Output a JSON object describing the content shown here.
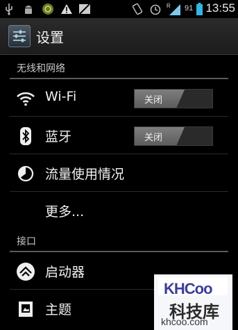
{
  "status_bar": {
    "time": "13:55",
    "battery_level": "91",
    "signal_label": "R",
    "icons": [
      "usb-icon",
      "android-debug-icon",
      "sync-icon",
      "warning-icon",
      "mute-icon",
      "vibrate-icon",
      "alarm-icon",
      "signal-icon",
      "battery-icon"
    ]
  },
  "action_bar": {
    "title": "设置",
    "icon": "settings-icon"
  },
  "sections": {
    "wireless": {
      "title": "无线和网络",
      "items": [
        {
          "label": "Wi-Fi",
          "icon": "wifi-icon",
          "toggle": "关闭"
        },
        {
          "label": "蓝牙",
          "icon": "bluetooth-icon",
          "toggle": "关闭"
        },
        {
          "label": "流量使用情况",
          "icon": "data-usage-icon"
        },
        {
          "label": "更多..."
        }
      ]
    },
    "interface": {
      "title": "接口",
      "items": [
        {
          "label": "启动器",
          "icon": "launcher-icon"
        },
        {
          "label": "主题",
          "icon": "theme-icon"
        }
      ]
    }
  },
  "watermark": {
    "brand": "KHCoo",
    "chinese": "科技库",
    "domain": "khcoo.com"
  },
  "colors": {
    "background": "#000000",
    "text": "#f2f2f2",
    "section_line": "#5a5a5a",
    "toggle_off": "#6e6e6e"
  }
}
